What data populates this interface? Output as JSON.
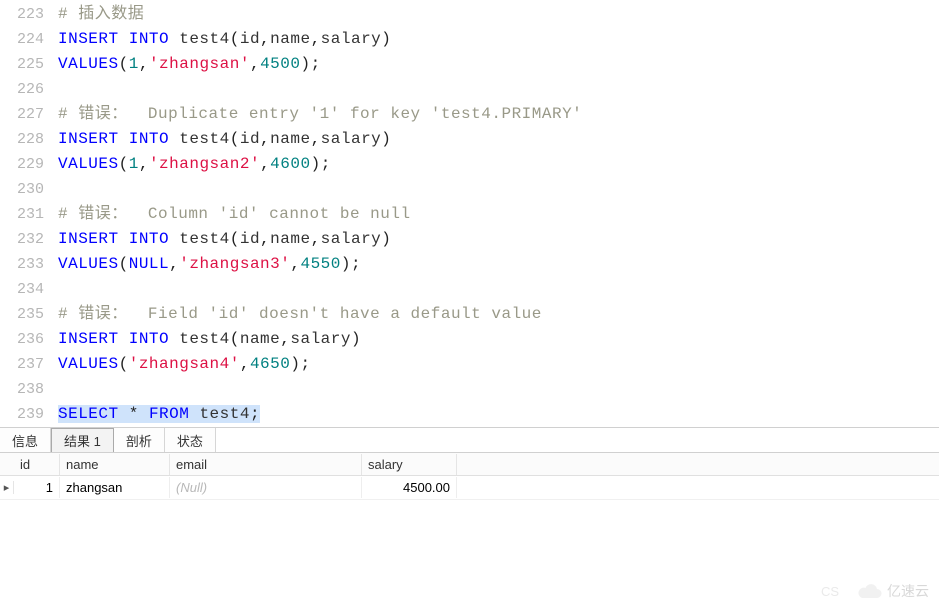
{
  "lines": [
    {
      "num": "223",
      "tokens": [
        [
          "cmt",
          "# 插入数据"
        ]
      ]
    },
    {
      "num": "224",
      "tokens": [
        [
          "kw",
          "INSERT"
        ],
        [
          "fn",
          " "
        ],
        [
          "kw",
          "INTO"
        ],
        [
          "fn",
          " test4"
        ],
        [
          "punct",
          "("
        ],
        [
          "fn",
          "id"
        ],
        [
          "punct",
          ","
        ],
        [
          "fn",
          "name"
        ],
        [
          "punct",
          ","
        ],
        [
          "fn",
          "salary"
        ],
        [
          "punct",
          ")"
        ]
      ]
    },
    {
      "num": "225",
      "tokens": [
        [
          "kw",
          "VALUES"
        ],
        [
          "punct",
          "("
        ],
        [
          "num",
          "1"
        ],
        [
          "punct",
          ","
        ],
        [
          "str",
          "'zhangsan'"
        ],
        [
          "punct",
          ","
        ],
        [
          "num",
          "4500"
        ],
        [
          "punct",
          ")"
        ],
        [
          "punct",
          ";"
        ]
      ]
    },
    {
      "num": "226",
      "tokens": []
    },
    {
      "num": "227",
      "tokens": [
        [
          "cmt",
          "# 错误：  Duplicate entry '1' for key 'test4.PRIMARY'"
        ]
      ]
    },
    {
      "num": "228",
      "tokens": [
        [
          "kw",
          "INSERT"
        ],
        [
          "fn",
          " "
        ],
        [
          "kw",
          "INTO"
        ],
        [
          "fn",
          " test4"
        ],
        [
          "punct",
          "("
        ],
        [
          "fn",
          "id"
        ],
        [
          "punct",
          ","
        ],
        [
          "fn",
          "name"
        ],
        [
          "punct",
          ","
        ],
        [
          "fn",
          "salary"
        ],
        [
          "punct",
          ")"
        ]
      ]
    },
    {
      "num": "229",
      "tokens": [
        [
          "kw",
          "VALUES"
        ],
        [
          "punct",
          "("
        ],
        [
          "num",
          "1"
        ],
        [
          "punct",
          ","
        ],
        [
          "str",
          "'zhangsan2'"
        ],
        [
          "punct",
          ","
        ],
        [
          "num",
          "4600"
        ],
        [
          "punct",
          ")"
        ],
        [
          "punct",
          ";"
        ]
      ]
    },
    {
      "num": "230",
      "tokens": []
    },
    {
      "num": "231",
      "tokens": [
        [
          "cmt",
          "# 错误：  Column 'id' cannot be null"
        ]
      ]
    },
    {
      "num": "232",
      "tokens": [
        [
          "kw",
          "INSERT"
        ],
        [
          "fn",
          " "
        ],
        [
          "kw",
          "INTO"
        ],
        [
          "fn",
          " test4"
        ],
        [
          "punct",
          "("
        ],
        [
          "fn",
          "id"
        ],
        [
          "punct",
          ","
        ],
        [
          "fn",
          "name"
        ],
        [
          "punct",
          ","
        ],
        [
          "fn",
          "salary"
        ],
        [
          "punct",
          ")"
        ]
      ]
    },
    {
      "num": "233",
      "tokens": [
        [
          "kw",
          "VALUES"
        ],
        [
          "punct",
          "("
        ],
        [
          "kw",
          "NULL"
        ],
        [
          "punct",
          ","
        ],
        [
          "str",
          "'zhangsan3'"
        ],
        [
          "punct",
          ","
        ],
        [
          "num",
          "4550"
        ],
        [
          "punct",
          ")"
        ],
        [
          "punct",
          ";"
        ]
      ]
    },
    {
      "num": "234",
      "tokens": []
    },
    {
      "num": "235",
      "tokens": [
        [
          "cmt",
          "# 错误：  Field 'id' doesn't have a default value"
        ]
      ]
    },
    {
      "num": "236",
      "tokens": [
        [
          "kw",
          "INSERT"
        ],
        [
          "fn",
          " "
        ],
        [
          "kw",
          "INTO"
        ],
        [
          "fn",
          " test4"
        ],
        [
          "punct",
          "("
        ],
        [
          "fn",
          "name"
        ],
        [
          "punct",
          ","
        ],
        [
          "fn",
          "salary"
        ],
        [
          "punct",
          ")"
        ]
      ]
    },
    {
      "num": "237",
      "tokens": [
        [
          "kw",
          "VALUES"
        ],
        [
          "punct",
          "("
        ],
        [
          "str",
          "'zhangsan4'"
        ],
        [
          "punct",
          ","
        ],
        [
          "num",
          "4650"
        ],
        [
          "punct",
          ")"
        ],
        [
          "punct",
          ";"
        ]
      ]
    },
    {
      "num": "238",
      "tokens": []
    },
    {
      "num": "239",
      "hl": true,
      "tokens": [
        [
          "kw",
          "SELECT"
        ],
        [
          "fn",
          " "
        ],
        [
          "punct",
          "*"
        ],
        [
          "fn",
          " "
        ],
        [
          "kw",
          "FROM"
        ],
        [
          "fn",
          " test4"
        ],
        [
          "punct",
          ";"
        ]
      ]
    }
  ],
  "tabs": {
    "info": "信息",
    "result": "结果 1",
    "profile": "剖析",
    "status": "状态"
  },
  "grid": {
    "headers": {
      "id": "id",
      "name": "name",
      "email": "email",
      "salary": "salary"
    },
    "rows": [
      {
        "id": "1",
        "name": "zhangsan",
        "email": "(Null)",
        "email_null": true,
        "salary": "4500.00"
      }
    ]
  },
  "rowMarker": "▸",
  "watermark": "亿速云",
  "cs": "CS"
}
